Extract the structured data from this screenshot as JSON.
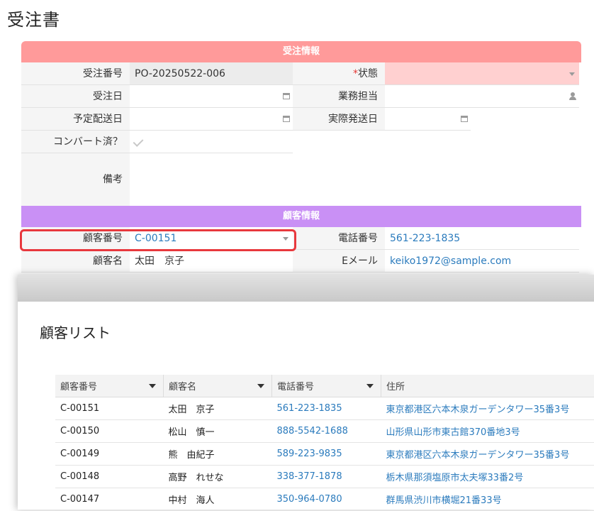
{
  "page_title": "受注書",
  "sections": {
    "order_info": "受注情報",
    "customer_info": "顧客情報"
  },
  "order": {
    "order_no_label": "受注番号",
    "order_no": "PO-20250522-006",
    "status_label": "状態",
    "status_required_mark": "*",
    "status_value": "",
    "order_date_label": "受注日",
    "order_date": "",
    "staff_label": "業務担当",
    "staff": "",
    "planned_ship_label": "予定配送日",
    "planned_ship": "",
    "actual_ship_label": "実際発送日",
    "actual_ship": "",
    "converted_label": "コンバート済？",
    "notes_label": "備考",
    "notes": ""
  },
  "customer": {
    "cust_no_label": "顧客番号",
    "cust_no": "C-00151",
    "phone_label": "電話番号",
    "phone": "561-223-1835",
    "name_label": "顧客名",
    "name": "太田　京子",
    "email_label": "Eメール",
    "email": "keiko1972@sample.com"
  },
  "modal": {
    "title": "顧客リスト",
    "columns": [
      "顧客番号",
      "顧客名",
      "電話番号",
      "住所"
    ],
    "rows": [
      {
        "no": "C-00151",
        "name": "太田　京子",
        "phone": "561-223-1835",
        "address": "東京都港区六本木泉ガーデンタワー35番3号"
      },
      {
        "no": "C-00150",
        "name": "松山　慎一",
        "phone": "888-5542-1688",
        "address": "山形県山形市東古館370番地3号"
      },
      {
        "no": "C-00149",
        "name": "熊　由紀子",
        "phone": "589-223-9835",
        "address": "東京都港区六本木泉ガーデンタワー35番3号"
      },
      {
        "no": "C-00148",
        "name": "高野　れせな",
        "phone": "338-377-1878",
        "address": "栃木県那須塩原市太夫塚33番2号"
      },
      {
        "no": "C-00147",
        "name": "中村　海人",
        "phone": "350-964-0780",
        "address": "群馬県渋川市横堀21番33号"
      }
    ]
  },
  "colors": {
    "order_header": "#ff9a9a",
    "customer_header": "#c990f5",
    "link": "#2b7bbd",
    "highlight": "#e8383d"
  }
}
